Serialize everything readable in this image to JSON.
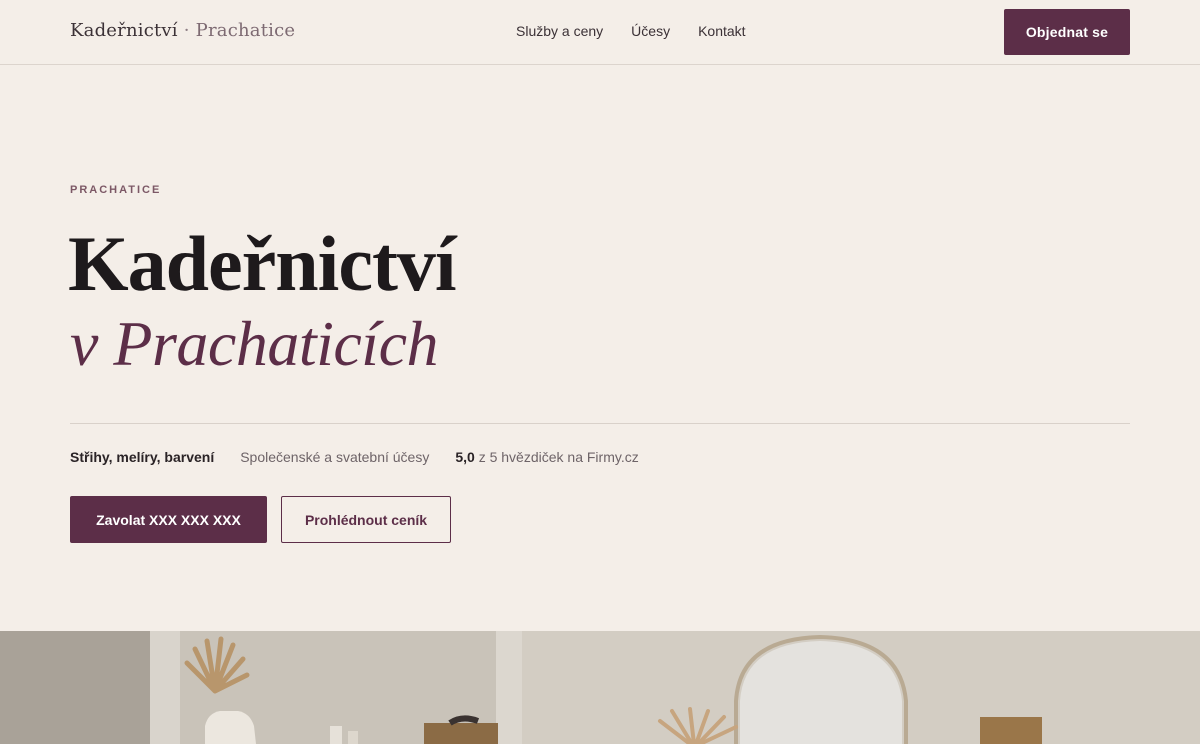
{
  "header": {
    "brand_name": "Kadeřnictví",
    "brand_separator": "·",
    "brand_city": "Prachatice",
    "nav": [
      {
        "label": "Služby a ceny"
      },
      {
        "label": "Účesy"
      },
      {
        "label": "Kontakt"
      }
    ],
    "order_label": "Objednat se"
  },
  "hero": {
    "eyebrow": "PRACHATICE",
    "title_main": "Kadeřnictví",
    "title_sub": "v Prachaticích",
    "features": {
      "item1": "Střihy, melíry, barvení",
      "item2": "Společenské a svatební účesy",
      "rating_value": "5,0",
      "rating_text": "z 5 hvězdiček na Firmy.cz"
    },
    "call_label": "Zavolat XXX XXX XXX",
    "price_label": "Prohlédnout ceník"
  },
  "colors": {
    "background": "#f4eee8",
    "accent": "#5c2e48"
  }
}
